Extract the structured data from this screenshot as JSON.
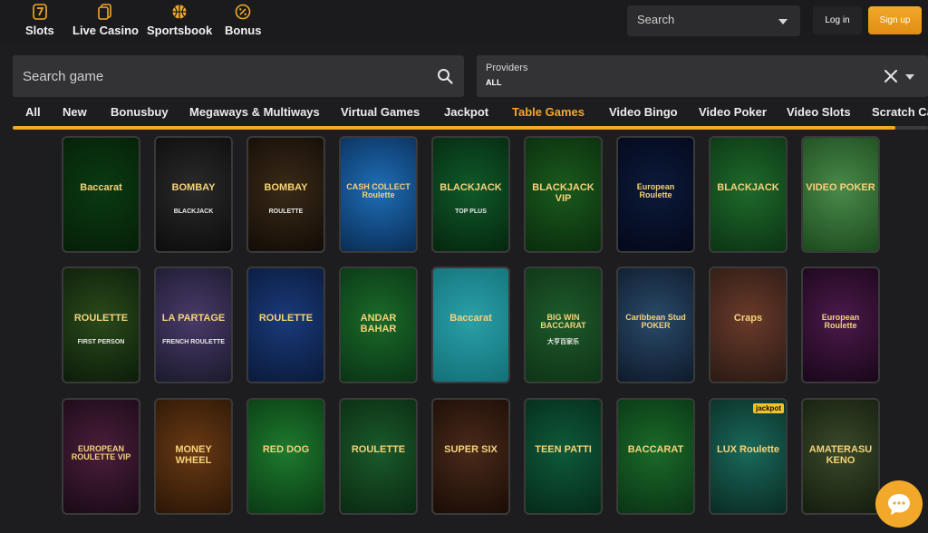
{
  "nav": {
    "items": [
      {
        "label": "Slots",
        "icon": "seven-icon"
      },
      {
        "label": "Live Casino",
        "icon": "cards-icon"
      },
      {
        "label": "Sportsbook",
        "icon": "basketball-icon"
      },
      {
        "label": "Bonus",
        "icon": "percent-badge-icon"
      }
    ],
    "search_label": "Search",
    "login_label": "Log in",
    "signup_label": "Sign up"
  },
  "filters": {
    "search_placeholder": "Search game",
    "providers_label": "Providers",
    "providers_value": "ALL"
  },
  "tabs": [
    {
      "label": "All"
    },
    {
      "label": "New"
    },
    {
      "label": "Bonusbuy"
    },
    {
      "label": "Megaways & Multiways"
    },
    {
      "label": "Virtual Games"
    },
    {
      "label": "Jackpot"
    },
    {
      "label": "Table Games",
      "active": true
    },
    {
      "label": "Video Bingo"
    },
    {
      "label": "Video Poker"
    },
    {
      "label": "Video Slots"
    },
    {
      "label": "Scratch Ca"
    }
  ],
  "games": {
    "row1": [
      {
        "title": "Baccarat",
        "colors": [
          "#0a3a12",
          "#061f08"
        ]
      },
      {
        "title": "BOMBAY",
        "subtitle": "BLACKJACK",
        "colors": [
          "#2a2a2a",
          "#0c0c0c"
        ]
      },
      {
        "title": "BOMBAY",
        "subtitle": "ROULETTE",
        "colors": [
          "#3a2a18",
          "#120c06"
        ]
      },
      {
        "title": "CASH COLLECT Roulette",
        "colors": [
          "#1e6fb8",
          "#0a2c55"
        ]
      },
      {
        "title": "BLACKJACK",
        "subtitle": "TOP PLUS",
        "colors": [
          "#0f5a2a",
          "#05260f"
        ]
      },
      {
        "title": "BLACKJACK VIP",
        "colors": [
          "#1a5a1e",
          "#0a2c0c"
        ]
      },
      {
        "title": "European Roulette",
        "colors": [
          "#0c1a3a",
          "#04081a"
        ]
      },
      {
        "title": "BLACKJACK",
        "colors": [
          "#1f6a2c",
          "#0b3413"
        ]
      },
      {
        "title": "VIDEO POKER",
        "colors": [
          "#4a8a4a",
          "#1c4a1e"
        ]
      }
    ],
    "row2": [
      {
        "title": "ROULETTE",
        "subtitle": "FIRST PERSON",
        "colors": [
          "#2a4a1a",
          "#0c1c0a"
        ]
      },
      {
        "title": "LA PARTAGE",
        "subtitle": "FRENCH ROULETTE",
        "colors": [
          "#4a3a6a",
          "#1a1a2c"
        ]
      },
      {
        "title": "ROULETTE",
        "colors": [
          "#1a3a7a",
          "#0a1a3a"
        ]
      },
      {
        "title": "ANDAR BAHAR",
        "colors": [
          "#1a6a2a",
          "#0a3414"
        ]
      },
      {
        "title": "Baccarat",
        "colors": [
          "#2aa0a8",
          "#137078"
        ]
      },
      {
        "title": "BIG WIN BACCARAT",
        "subtitle": "大亨百家乐",
        "colors": [
          "#1e5a2a",
          "#0e3416"
        ]
      },
      {
        "title": "Caribbean Stud POKER",
        "colors": [
          "#2a4a6a",
          "#0e1a2a"
        ]
      },
      {
        "title": "Craps",
        "colors": [
          "#6a3a2a",
          "#2a1a14"
        ]
      },
      {
        "title": "European Roulette",
        "colors": [
          "#4a1a4a",
          "#1a061a"
        ]
      }
    ],
    "row3": [
      {
        "title": "EUROPEAN ROULETTE VIP",
        "colors": [
          "#4a1e3a",
          "#1a0a16"
        ]
      },
      {
        "title": "MONEY WHEEL",
        "colors": [
          "#6a3a14",
          "#2a1606"
        ]
      },
      {
        "title": "RED DOG",
        "colors": [
          "#1e7a2e",
          "#0a3a14"
        ]
      },
      {
        "title": "ROULETTE",
        "colors": [
          "#1a5a2a",
          "#0a2a12"
        ]
      },
      {
        "title": "SUPER SIX",
        "colors": [
          "#4a2a1a",
          "#1a0c06"
        ]
      },
      {
        "title": "TEEN PATTI",
        "colors": [
          "#0e5a3a",
          "#052a1a"
        ]
      },
      {
        "title": "BACCARAT",
        "colors": [
          "#1a6a2a",
          "#0a3414"
        ]
      },
      {
        "title": "LUX Roulette",
        "badge": "jackpot",
        "colors": [
          "#1a6a5a",
          "#0a2a24"
        ]
      },
      {
        "title": "AMATERASU KENO",
        "colors": [
          "#3a4a2a",
          "#141c0e"
        ]
      }
    ]
  },
  "colors": {
    "accent": "#f2a82a",
    "background": "#1d1d1f",
    "panel": "#333336"
  }
}
